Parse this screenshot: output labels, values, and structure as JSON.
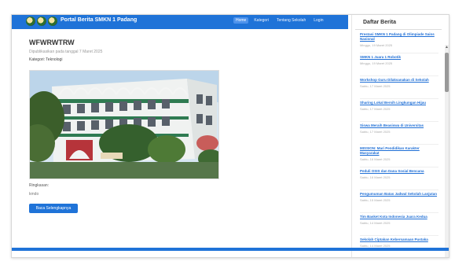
{
  "header": {
    "brand": "Portal Berita SMKN 1 Padang",
    "nav": [
      "Home",
      "Kategori",
      "Tentang Sekolah",
      "Login"
    ]
  },
  "post": {
    "title": "WFWRWTRW",
    "meta": "Dipublikasikan pada tanggal 7 Maret 2025",
    "category": "Kategori: Teknologi",
    "summary_label": "Ringkasan:",
    "summary_text": "kmdo",
    "read_more": "Baca Selengkapnya"
  },
  "sidebar": {
    "title": "Daftar Berita",
    "items": [
      {
        "title": "Prestasi SMKN 1 Padang di Olimpiade Sains Nasional",
        "date": "Minggu, 19 Maret 2025"
      },
      {
        "title": "SMKN 1 Juara 1 Robotik",
        "date": "Minggu, 19 Maret 2025"
      },
      {
        "title": "Workshop Guru Dilaksanakan di Sekolah",
        "date": "Sabtu, 17 Maret 2025"
      },
      {
        "title": "Sharing Lokal Bersih Lingkungan Hijau",
        "date": "Sabtu, 17 Maret 2025"
      },
      {
        "title": "Siswa Meraih Beasiswa di Universitas",
        "date": "Sabtu, 17 Maret 2025"
      },
      {
        "title": "MISSION: Mari Pendidikan Karakter Masyarakat",
        "date": "Sabtu, 16 Maret 2025"
      },
      {
        "title": "Peduli OSIS dan Dana Sosial Bencana",
        "date": "Sabtu, 16 Maret 2025"
      },
      {
        "title": "Pengumuman Batas Jadwal Sekolah Lanjutan",
        "date": "Sabtu, 15 Maret 2025"
      },
      {
        "title": "Tim Basket Kota Indonesia Juara Kedua",
        "date": "Sabtu, 14 Maret 2025"
      },
      {
        "title": "Sekolah Ciptakan Kebersamaan Pustaka",
        "date": "Sabtu, 14 Maret 2025"
      }
    ]
  },
  "colors": {
    "primary": "#1f73d8",
    "link": "#1f6fd6"
  },
  "icons": {
    "logos": [
      "school-logo-icon",
      "province-emblem-icon",
      "city-emblem-icon"
    ],
    "scroll_up": "▲",
    "scroll_down": "▼"
  }
}
